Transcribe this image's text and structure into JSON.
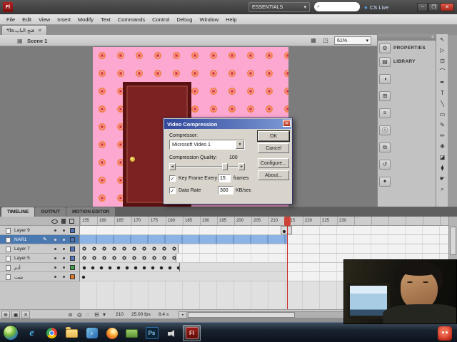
{
  "icons": {
    "app_logo": "Fl",
    "search": "⌕",
    "caret_down": "▾",
    "minimize": "−",
    "restore": "❐",
    "close": "✕",
    "tab_close": "✕",
    "back": "←",
    "scene_clapper": "▦",
    "edit_scene": "▦",
    "edit_symbol": "◳",
    "dock_collapse": "«",
    "dialog_close": "✕",
    "check": "✓",
    "slider_left": "◄",
    "slider_right": "►",
    "select_arrow": "▼",
    "pencil": "✎",
    "new_layer": "⊕",
    "new_folder": "▣",
    "delete_layer": "✕",
    "center_frame": "⧈",
    "onion_skin": "◎",
    "onion_outline": "◌",
    "edit_multiple": "⊟",
    "marker_menu": "▾",
    "scroll_left": "◂",
    "scroll_right": "▸",
    "play_glyph": "♪",
    "cs_live_orb": "●"
  },
  "titlebar": {
    "workspace": "ESSENTIALS",
    "cs_live": "CS Live"
  },
  "menu": {
    "items": [
      "File",
      "Edit",
      "View",
      "Insert",
      "Modify",
      "Text",
      "Commands",
      "Control",
      "Debug",
      "Window",
      "Help"
    ]
  },
  "document": {
    "tab_title": "فتح الباب.fla*"
  },
  "edit_bar": {
    "scene": "Scene 1",
    "zoom": "61%"
  },
  "dialog": {
    "title": "Video Compression",
    "compressor_label": "Compressor:",
    "compressor_value": "Microsoft Video 1",
    "quality_label": "Compression Quality:",
    "quality_value": "100",
    "keyframe_label": "Key Frame Every",
    "keyframe_value": "15",
    "keyframe_unit": "frames",
    "datarate_label": "Data Rate",
    "datarate_value": "300",
    "datarate_unit": "KB/sec",
    "ok": "OK",
    "cancel": "Cancel",
    "configure": "Configure...",
    "about": "About..."
  },
  "dock": {
    "items": [
      {
        "label": "PROPERTIES",
        "glyph": "⚙"
      },
      {
        "label": "LIBRARY",
        "glyph": "▤"
      },
      {
        "glyph": "◑"
      },
      {
        "glyph": "⊞"
      },
      {
        "glyph": "≡"
      },
      {
        "glyph": "ⓘ"
      },
      {
        "glyph": "⧉"
      },
      {
        "glyph": "↺"
      },
      {
        "glyph": "✦"
      }
    ]
  },
  "tools": {
    "items": [
      {
        "name": "selection",
        "glyph": "↖"
      },
      {
        "name": "subselection",
        "glyph": "▷"
      },
      {
        "name": "free-transform",
        "glyph": "⊡"
      },
      {
        "name": "lasso",
        "glyph": "⌒"
      },
      {
        "name": "pen",
        "glyph": "✒"
      },
      {
        "name": "text",
        "glyph": "T"
      },
      {
        "name": "line",
        "glyph": "╲"
      },
      {
        "name": "rectangle",
        "glyph": "▭"
      },
      {
        "name": "pencil",
        "glyph": "✎"
      },
      {
        "name": "brush",
        "glyph": "✏"
      },
      {
        "name": "deco",
        "glyph": "❋"
      },
      {
        "name": "paint-bucket",
        "glyph": "◪"
      },
      {
        "name": "eyedropper",
        "glyph": "⧫"
      },
      {
        "name": "hand",
        "glyph": "☛"
      },
      {
        "name": "zoom",
        "glyph": "⌕"
      }
    ]
  },
  "timeline": {
    "tabs": [
      "TIMELINE",
      "OUTPUT",
      "MOTION EDITOR"
    ],
    "ruler": [
      "155",
      "160",
      "165",
      "170",
      "175",
      "180",
      "185",
      "190",
      "195",
      "200",
      "205",
      "210",
      "215",
      "220",
      "225",
      "230"
    ],
    "playhead_frame": "210",
    "layers": [
      {
        "name": "Layer 9",
        "color": "#4f76bd"
      },
      {
        "name": "NAR1",
        "color": "#4f76bd",
        "selected": true
      },
      {
        "name": "Layer 7",
        "color": "#4f76bd"
      },
      {
        "name": "Layer 5",
        "color": "#4f76bd"
      },
      {
        "name": "أدم",
        "color": "#3fa24b"
      },
      {
        "name": "يثبت",
        "color": "#e0782a"
      }
    ],
    "status": {
      "frame": "210",
      "fps": "25.00 fps",
      "time": "8.4 s"
    }
  },
  "taskbar": {
    "ie_letter": "e",
    "ps_label": "Ps",
    "fl_label": "Fl"
  }
}
